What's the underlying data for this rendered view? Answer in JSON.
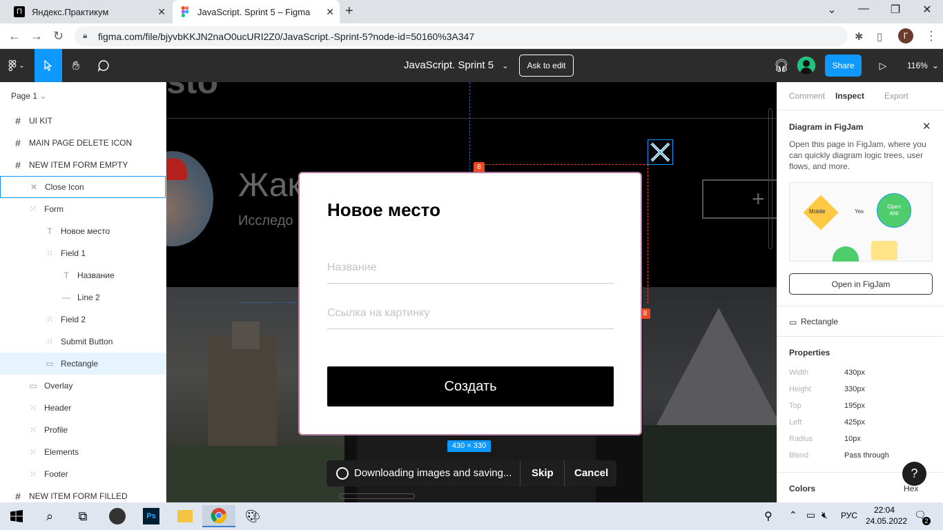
{
  "browser": {
    "tabs": [
      {
        "title": "Яндекс.Практикум",
        "favicon": "П"
      },
      {
        "title": "JavaScript. Sprint 5 – Figma"
      }
    ],
    "url": "figma.com/file/bjyvbKKJN2naO0ucURI2Z0/JavaScript.-Sprint-5?node-id=50160%3A347",
    "avatar_letter": "Г"
  },
  "toolbar": {
    "file_title": "JavaScript. Sprint 5",
    "ask_to_edit": "Ask to edit",
    "share": "Share",
    "zoom": "116%"
  },
  "layers": {
    "page": "Page 1",
    "items": [
      {
        "label": "UI KIT",
        "icon": "#"
      },
      {
        "label": "MAIN PAGE DELETE ICON",
        "icon": "#"
      },
      {
        "label": "NEW ITEM FORM EMPTY",
        "icon": "#"
      },
      {
        "label": "Close Icon",
        "icon": "✕"
      },
      {
        "label": "Form",
        "icon": "⁙"
      },
      {
        "label": "Новое место",
        "icon": "T"
      },
      {
        "label": "Field 1",
        "icon": "⁙"
      },
      {
        "label": "Название",
        "icon": "T"
      },
      {
        "label": "Line 2",
        "icon": "—"
      },
      {
        "label": "Field 2",
        "icon": "⁙"
      },
      {
        "label": "Submit Button",
        "icon": "⁙"
      },
      {
        "label": "Rectangle",
        "icon": "▭"
      },
      {
        "label": "Overlay",
        "icon": "▭"
      },
      {
        "label": "Header",
        "icon": "⁙"
      },
      {
        "label": "Profile",
        "icon": "⁙"
      },
      {
        "label": "Elements",
        "icon": "⁙"
      },
      {
        "label": "Footer",
        "icon": "⁙"
      },
      {
        "label": "NEW ITEM FORM FILLED",
        "icon": "#"
      }
    ]
  },
  "canvas": {
    "profile_name_partial": "Жак",
    "profile_about_partial": "Исследо",
    "logo_partial": "sto",
    "form": {
      "title": "Новое место",
      "field1_placeholder": "Название",
      "field2_placeholder": "Ссылка на картинку",
      "submit": "Создать"
    },
    "spacing_badge_1": "8",
    "spacing_badge_2": "8",
    "size_label": "430 × 330",
    "download_status": "Downloading images and saving...",
    "skip": "Skip",
    "cancel": "Cancel"
  },
  "inspect": {
    "tabs": [
      "Comment",
      "Inspect",
      "Export"
    ],
    "promo_title": "Diagram in FigJam",
    "promo_text": "Open this page in FigJam, where you can quickly diagram logic trees, user flows, and more.",
    "promo_mobile": "Mobile",
    "promo_yes": "Yes",
    "promo_open_app": "Open app",
    "open_figjam": "Open in FigJam",
    "selected": "Rectangle",
    "properties_title": "Properties",
    "properties": [
      {
        "label": "Width",
        "value": "430px"
      },
      {
        "label": "Height",
        "value": "330px"
      },
      {
        "label": "Top",
        "value": "195px"
      },
      {
        "label": "Left",
        "value": "425px"
      },
      {
        "label": "Radius",
        "value": "10px"
      },
      {
        "label": "Blend",
        "value": "Pass through"
      }
    ],
    "colors_title": "Colors",
    "color_format": "Hex"
  },
  "taskbar": {
    "lang": "РУС",
    "time": "22:04",
    "date": "24.05.2022",
    "notifications": "2"
  },
  "colors": {
    "accent": "#0d99ff",
    "toolbar": "#2c2c2c",
    "badge": "#f24822"
  }
}
